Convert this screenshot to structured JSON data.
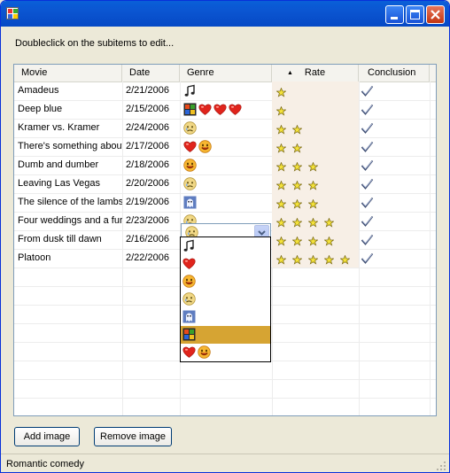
{
  "window": {
    "title": ""
  },
  "hint": "Doubleclick on the subitems to edit...",
  "columns": {
    "movie": "Movie",
    "date": "Date",
    "genre": "Genre",
    "rate": "Rate",
    "conclusion": "Conclusion",
    "sort_indicator": "▲"
  },
  "rows": [
    {
      "movie": "Amadeus",
      "date": "2/21/2006",
      "genre": [
        "music"
      ],
      "rate": 1,
      "conclusion": "check"
    },
    {
      "movie": "Deep blue",
      "date": "2/15/2006",
      "genre": [
        "film",
        "heart",
        "heart",
        "heart"
      ],
      "rate": 1,
      "conclusion": "check"
    },
    {
      "movie": "Kramer vs. Kramer",
      "date": "2/24/2006",
      "genre": [
        "sad-face"
      ],
      "rate": 2,
      "conclusion": "check"
    },
    {
      "movie": "There's something about",
      "date": "2/17/2006",
      "genre": [
        "heart",
        "smile"
      ],
      "rate": 2,
      "conclusion": "check"
    },
    {
      "movie": "Dumb and dumber",
      "date": "2/18/2006",
      "genre": [
        "smile"
      ],
      "rate": 3,
      "conclusion": "check"
    },
    {
      "movie": "Leaving Las Vegas",
      "date": "2/20/2006",
      "genre": [
        "sad-face"
      ],
      "rate": 3,
      "conclusion": "check"
    },
    {
      "movie": "The silence of the lambs",
      "date": "2/19/2006",
      "genre": [
        "ghost"
      ],
      "rate": 3,
      "conclusion": "check"
    },
    {
      "movie": "Four weddings and a fur",
      "date": "2/23/2006",
      "genre": [
        "sad-face"
      ],
      "rate": 4,
      "conclusion": "check"
    },
    {
      "movie": "From dusk till dawn",
      "date": "2/16/2006",
      "genre": [],
      "rate": 4,
      "conclusion": "check"
    },
    {
      "movie": "Platoon",
      "date": "2/22/2006",
      "genre": [],
      "rate": 5,
      "conclusion": "check"
    }
  ],
  "combo": {
    "selected": [
      "sad-face"
    ]
  },
  "dropdown_options": [
    {
      "icons": [
        "music"
      ],
      "selected": false
    },
    {
      "icons": [
        "heart"
      ],
      "selected": false
    },
    {
      "icons": [
        "smile"
      ],
      "selected": false
    },
    {
      "icons": [
        "sad-face"
      ],
      "selected": false
    },
    {
      "icons": [
        "ghost"
      ],
      "selected": false
    },
    {
      "icons": [
        "film"
      ],
      "selected": true
    },
    {
      "icons": [
        "heart",
        "smile"
      ],
      "selected": false
    }
  ],
  "buttons": {
    "add_image": "Add image",
    "remove_image": "Remove image"
  },
  "status": "Romantic comedy",
  "colors": {
    "title_bar": "#0b55d1",
    "selection": "#d6a433",
    "rate_column": "#f7efe6"
  }
}
